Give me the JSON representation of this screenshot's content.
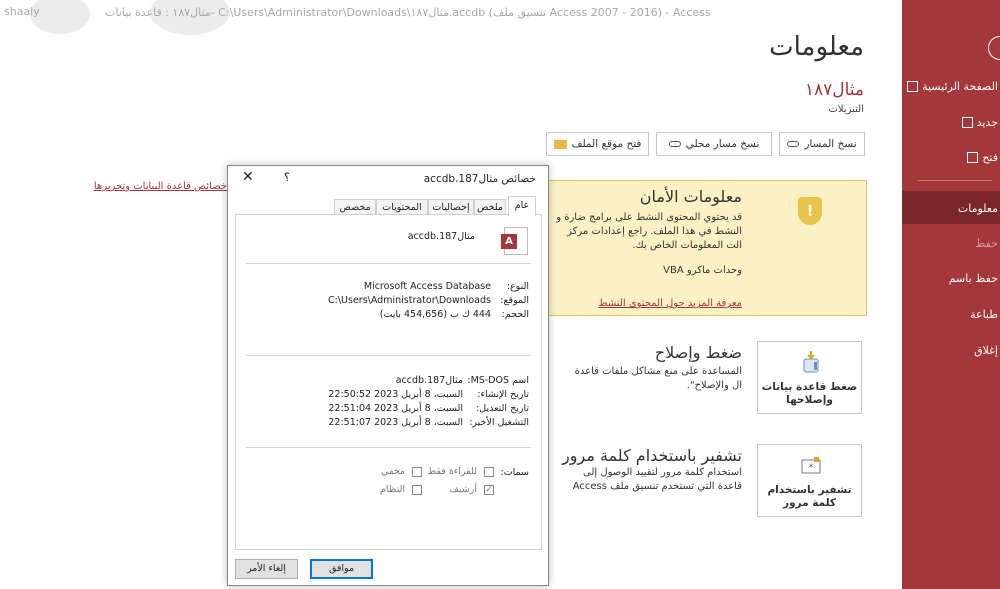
{
  "window": {
    "title_main": "مثال١٨٧ : قاعدة بيانات- C:\\Users\\Administrator\\Downloads\\مثال١٨٧.accdb (تنسيق ملف Access 2007 - 2016) - Access",
    "user": "shaaly"
  },
  "sidebar": {
    "items": [
      {
        "label": "الصفحة الرئيسية",
        "icon": "home-icon"
      },
      {
        "label": "جديد",
        "icon": "new-file-icon"
      },
      {
        "label": "فتح",
        "icon": "open-folder-icon"
      },
      {
        "label": "معلومات"
      },
      {
        "label": "حفظ"
      },
      {
        "label": "حفظ باسم"
      },
      {
        "label": "طباعة"
      },
      {
        "label": "إغلاق"
      }
    ]
  },
  "main": {
    "heading": "معلومات",
    "db_name": "مثال١٨٧",
    "db_folder": "التنزيلات",
    "buttons": {
      "copy_path": "نسخ المسار",
      "copy_local_path": "نسخ مسار محلي",
      "open_file_location": "فتح موقع الملف"
    },
    "left_link": "خصائص قاعدة البيانات وتحريرها",
    "security": {
      "title": "معلومات الأمان",
      "text": "قد يحتوي المحتوى النشط على برامج ضارة و النشط في هذا الملف. راجع إعدادات مركز الت المعلومات الخاص بك.",
      "vba": "وحدات ماكرو VBA",
      "link": "معرفة المزيد حول المحتوى النشط"
    },
    "compact": {
      "title": "ضغط وإصلاح",
      "desc": "المساعدة على منع مشاكل ملفات قاعدة ال والإصلاح\".",
      "tile_label": "ضغط قاعدة بيانات وإصلاحها"
    },
    "encrypt": {
      "title": "تشفير باستخدام كلمة مرور",
      "desc": "استخدام كلمة مرور لتقييد الوصول إلى قاعدة التي تستخدم تنسيق ملف Access ٢٠٠٧ ft",
      "tile_label": "تشفير باستخدام كلمة مرور"
    }
  },
  "dialog": {
    "title": "خصائص مثال187.accdb",
    "help": "؟",
    "close": "✕",
    "tabs": [
      "عام",
      "ملخص",
      "إحصاليات",
      "المحتويات",
      "مخصص"
    ],
    "file_name": "مثال187.accdb",
    "type_label": "النوع:",
    "type_value": "Microsoft Access Database",
    "location_label": "الموقع:",
    "location_value": "C:\\Users\\Administrator\\Downloads",
    "size_label": "الحجم:",
    "size_value": "444 ك ب (454,656 بايت)",
    "msdos_label": "اسم MS-DOS:",
    "msdos_value": "مثال187.accdb",
    "created_label": "تاريخ الإنشاء:",
    "created_value": "السبت، 8 أبريل 2023 22:50:52",
    "modified_label": "تاريخ التعديل:",
    "modified_value": "السبت، 8 أبريل 2023 22:51:04",
    "accessed_label": "التشغيل الأخير:",
    "accessed_value": "السبت، 8 أبريل 2023 22:51:07",
    "attrs_label": "سمات:",
    "readonly": "للقراءة فقط",
    "hidden": "مخفي",
    "archive": "أرشيف",
    "system": "النظام",
    "ok": "موافق",
    "cancel": "إلغاء الأمر"
  }
}
